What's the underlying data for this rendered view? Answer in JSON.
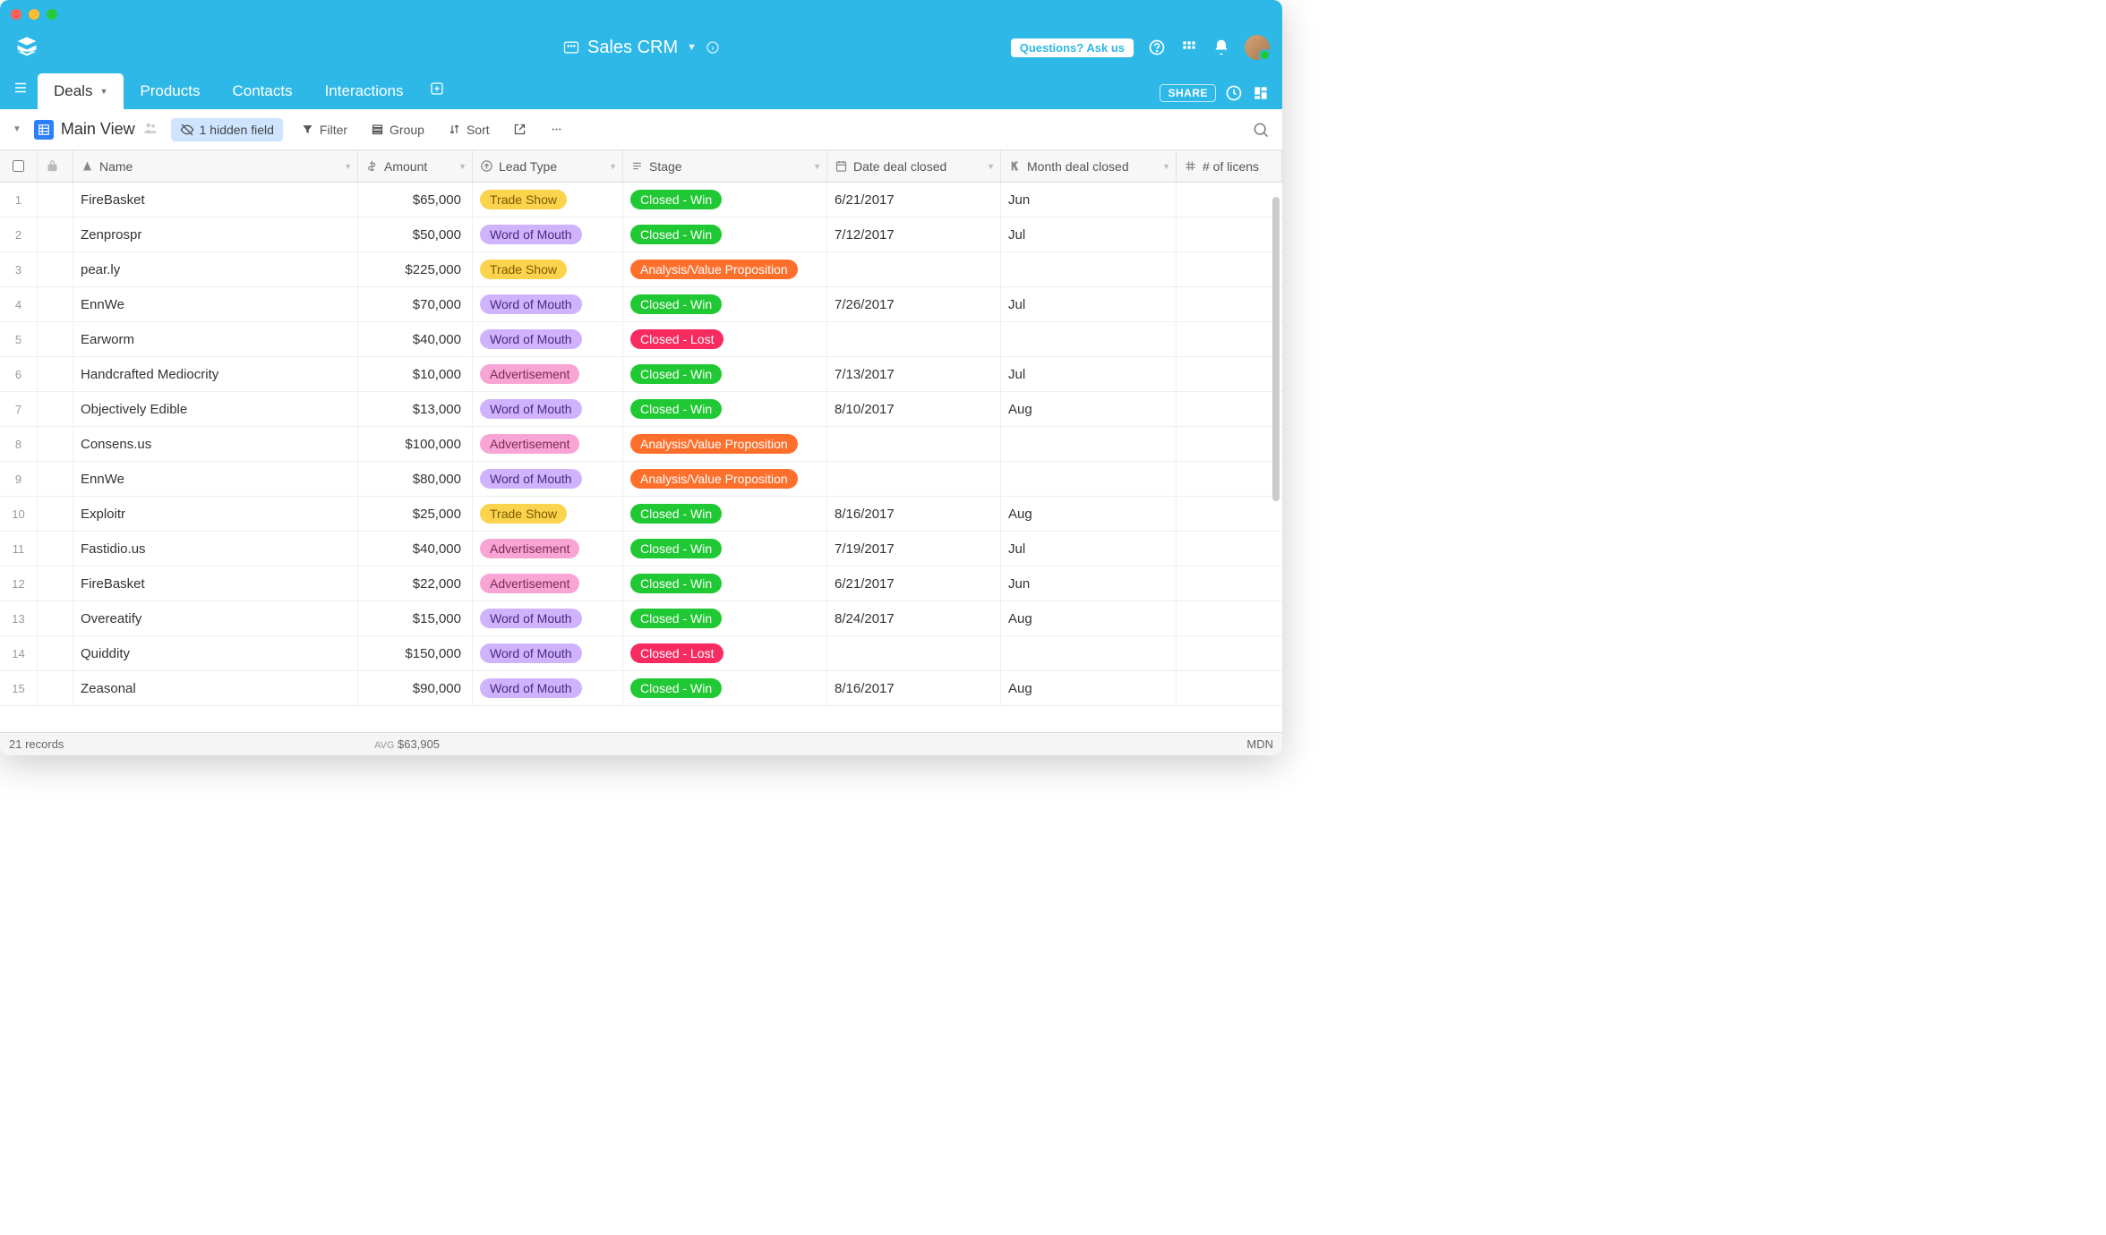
{
  "app": {
    "title": "Sales CRM"
  },
  "topnav": {
    "ask_us": "Questions? Ask us"
  },
  "tabs": {
    "items": [
      {
        "label": "Deals",
        "active": true
      },
      {
        "label": "Products",
        "active": false
      },
      {
        "label": "Contacts",
        "active": false
      },
      {
        "label": "Interactions",
        "active": false
      }
    ],
    "share": "SHARE"
  },
  "toolbar": {
    "view_name": "Main View",
    "hidden_field": "1 hidden field",
    "filter": "Filter",
    "group": "Group",
    "sort": "Sort"
  },
  "columns": {
    "name": "Name",
    "amount": "Amount",
    "lead_type": "Lead Type",
    "stage": "Stage",
    "date_closed": "Date deal closed",
    "month_closed": "Month deal closed",
    "licenses": "# of licens"
  },
  "lead_types": {
    "tradeshow": "Trade Show",
    "wordofmouth": "Word of Mouth",
    "advertisement": "Advertisement"
  },
  "stages": {
    "closedwin": "Closed - Win",
    "closedlost": "Closed - Lost",
    "analysis": "Analysis/Value Proposition"
  },
  "rows": [
    {
      "num": "1",
      "name": "FireBasket",
      "amount": "$65,000",
      "lead": "tradeshow",
      "stage": "closedwin",
      "date": "6/21/2017",
      "month": "Jun"
    },
    {
      "num": "2",
      "name": "Zenprospr",
      "amount": "$50,000",
      "lead": "wordofmouth",
      "stage": "closedwin",
      "date": "7/12/2017",
      "month": "Jul"
    },
    {
      "num": "3",
      "name": "pear.ly",
      "amount": "$225,000",
      "lead": "tradeshow",
      "stage": "analysis",
      "date": "",
      "month": ""
    },
    {
      "num": "4",
      "name": "EnnWe",
      "amount": "$70,000",
      "lead": "wordofmouth",
      "stage": "closedwin",
      "date": "7/26/2017",
      "month": "Jul"
    },
    {
      "num": "5",
      "name": "Earworm",
      "amount": "$40,000",
      "lead": "wordofmouth",
      "stage": "closedlost",
      "date": "",
      "month": ""
    },
    {
      "num": "6",
      "name": "Handcrafted Mediocrity",
      "amount": "$10,000",
      "lead": "advertisement",
      "stage": "closedwin",
      "date": "7/13/2017",
      "month": "Jul"
    },
    {
      "num": "7",
      "name": "Objectively Edible",
      "amount": "$13,000",
      "lead": "wordofmouth",
      "stage": "closedwin",
      "date": "8/10/2017",
      "month": "Aug"
    },
    {
      "num": "8",
      "name": "Consens.us",
      "amount": "$100,000",
      "lead": "advertisement",
      "stage": "analysis",
      "date": "",
      "month": ""
    },
    {
      "num": "9",
      "name": "EnnWe",
      "amount": "$80,000",
      "lead": "wordofmouth",
      "stage": "analysis",
      "date": "",
      "month": ""
    },
    {
      "num": "10",
      "name": "Exploitr",
      "amount": "$25,000",
      "lead": "tradeshow",
      "stage": "closedwin",
      "date": "8/16/2017",
      "month": "Aug"
    },
    {
      "num": "11",
      "name": "Fastidio.us",
      "amount": "$40,000",
      "lead": "advertisement",
      "stage": "closedwin",
      "date": "7/19/2017",
      "month": "Jul"
    },
    {
      "num": "12",
      "name": "FireBasket",
      "amount": "$22,000",
      "lead": "advertisement",
      "stage": "closedwin",
      "date": "6/21/2017",
      "month": "Jun"
    },
    {
      "num": "13",
      "name": "Overeatify",
      "amount": "$15,000",
      "lead": "wordofmouth",
      "stage": "closedwin",
      "date": "8/24/2017",
      "month": "Aug"
    },
    {
      "num": "14",
      "name": "Quiddity",
      "amount": "$150,000",
      "lead": "wordofmouth",
      "stage": "closedlost",
      "date": "",
      "month": ""
    },
    {
      "num": "15",
      "name": "Zeasonal",
      "amount": "$90,000",
      "lead": "wordofmouth",
      "stage": "closedwin",
      "date": "8/16/2017",
      "month": "Aug"
    }
  ],
  "footer": {
    "record_count": "21 records",
    "avg_label": "AVG",
    "avg_value": "$63,905",
    "right": "MDN"
  }
}
